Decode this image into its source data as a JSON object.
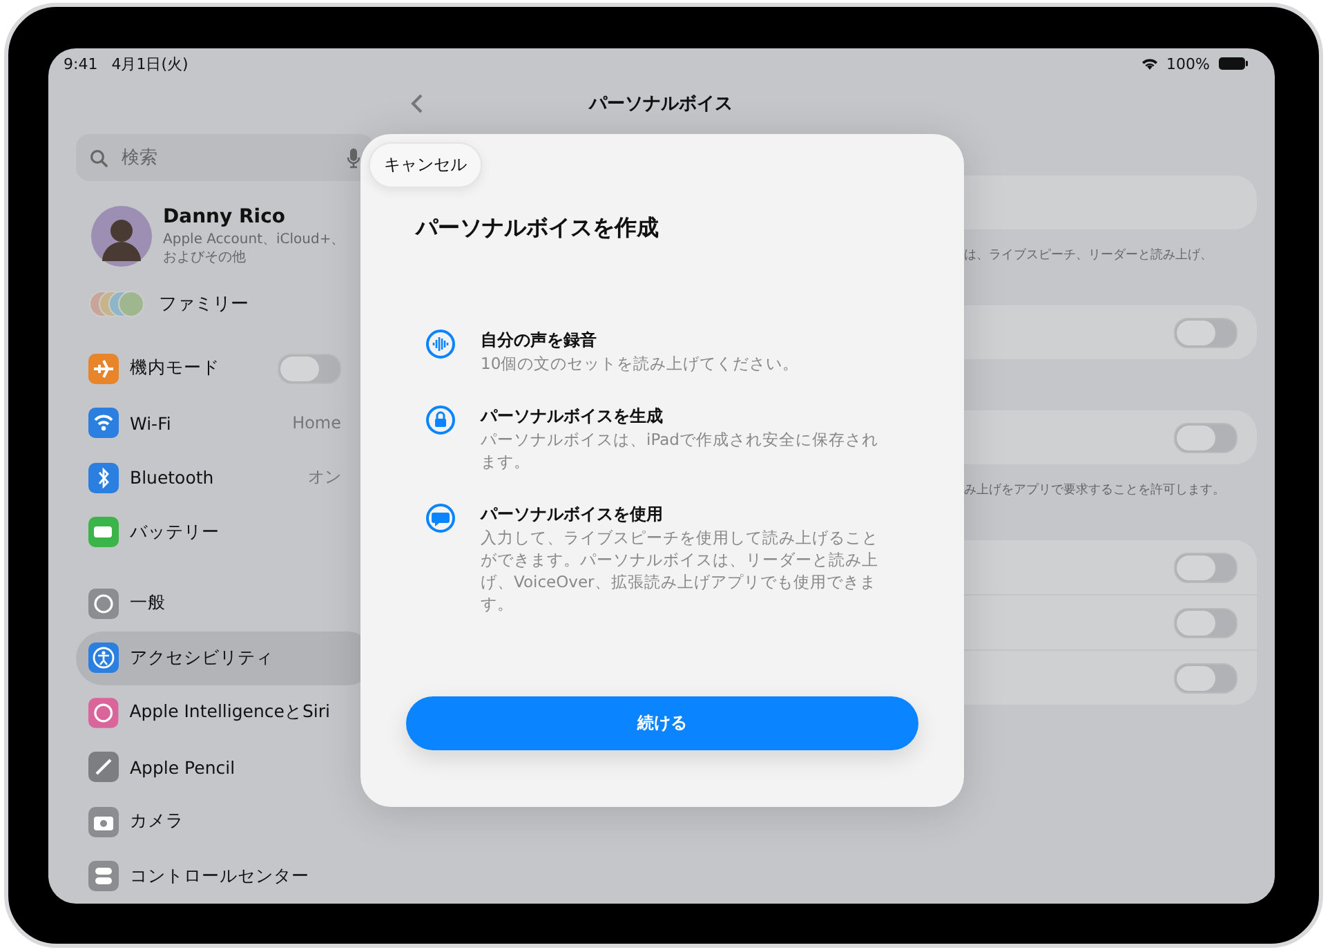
{
  "status_bar": {
    "time": "9:41",
    "date": "4月1日(火)",
    "battery": "100%"
  },
  "sidebar": {
    "search": {
      "placeholder": "検索"
    },
    "profile": {
      "name": "Danny Rico",
      "subtitle": "Apple Account、iCloud+、およびその他"
    },
    "family": {
      "label": "ファミリー"
    },
    "groups": [
      [
        {
          "label": "機内モード",
          "kind": "toggle",
          "on": false,
          "color": "#e8842a",
          "selected": false
        },
        {
          "label": "Wi-Fi",
          "kind": "value",
          "value": "Home",
          "color": "#2a7fe0",
          "selected": false
        },
        {
          "label": "Bluetooth",
          "kind": "value",
          "value": "オン",
          "color": "#2a7fe0",
          "selected": false
        },
        {
          "label": "バッテリー",
          "kind": "plain",
          "color": "#3bb54a",
          "selected": false
        }
      ],
      [
        {
          "label": "一般",
          "kind": "plain",
          "color": "#8c8d91",
          "selected": false
        },
        {
          "label": "アクセシビリティ",
          "kind": "plain",
          "color": "#2a7fe0",
          "selected": true
        },
        {
          "label": "Apple IntelligenceとSiri",
          "kind": "plain",
          "color": "#d9659a",
          "selected": false
        },
        {
          "label": "Apple Pencil",
          "kind": "plain",
          "color": "#7d7e82",
          "selected": false
        },
        {
          "label": "カメラ",
          "kind": "plain",
          "color": "#8c8d91",
          "selected": false
        },
        {
          "label": "コントロールセンター",
          "kind": "plain",
          "color": "#8c8d91",
          "selected": false
        }
      ]
    ]
  },
  "detail": {
    "title": "パーソナルボイス",
    "sections": [
      {
        "rows": [
          {
            "kind": "blank"
          }
        ],
        "footnote": "は、ライブスピーチ、リーダーと読み上げ、"
      },
      {
        "rows": [
          {
            "kind": "toggle",
            "on": false
          }
        ]
      },
      {
        "rows": [
          {
            "kind": "toggle",
            "on": false
          }
        ],
        "footnote": "み上げをアプリで要求することを許可します。"
      },
      {
        "rows": [
          {
            "kind": "toggle",
            "on": false
          },
          {
            "kind": "toggle",
            "on": false
          },
          {
            "kind": "toggle",
            "on": false
          }
        ]
      }
    ]
  },
  "modal": {
    "cancel": "キャンセル",
    "title": "パーソナルボイスを作成",
    "features": [
      {
        "title": "自分の声を録音",
        "description": "10個の文のセットを読み上げてください。"
      },
      {
        "title": "パーソナルボイスを生成",
        "description": "パーソナルボイスは、iPadで作成され安全に保存されます。"
      },
      {
        "title": "パーソナルボイスを使用",
        "description": "入力して、ライブスピーチを使用して読み上げることができます。パーソナルボイスは、リーダーと読み上げ、VoiceOver、拡張読み上げアプリでも使用できます。"
      }
    ],
    "continue": "続ける"
  }
}
